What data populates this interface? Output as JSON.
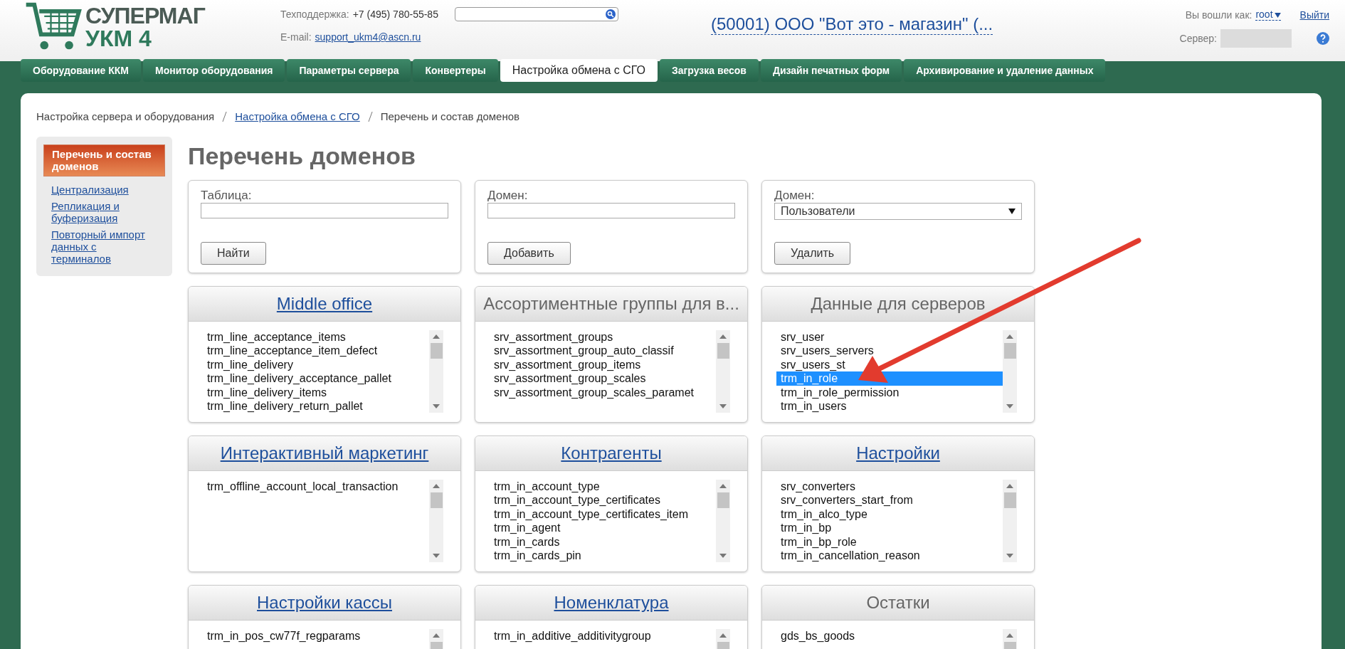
{
  "header": {
    "logo": {
      "line1": "СУПЕРМАГ",
      "line2": "УКМ 4"
    },
    "support_label": "Техподдержка:",
    "support_phone": "+7 (495) 780-55-85",
    "email_label": "E-mail:",
    "email": "support_ukm4@ascn.ru",
    "store": "(50001) ООО \"Вот это - магазин\" (...",
    "login_label": "Вы вошли как:",
    "user": "root",
    "logout": "Выйти",
    "server_label": "Сервер:"
  },
  "tabs": [
    {
      "label": "Оборудование ККМ",
      "selected": false
    },
    {
      "label": "Монитор оборудования",
      "selected": false
    },
    {
      "label": "Параметры сервера",
      "selected": false
    },
    {
      "label": "Конвертеры",
      "selected": false
    },
    {
      "label": "Настройка обмена с СГО",
      "selected": true
    },
    {
      "label": "Загрузка весов",
      "selected": false
    },
    {
      "label": "Дизайн печатных форм",
      "selected": false
    },
    {
      "label": "Архивирование и удаление данных",
      "selected": false
    }
  ],
  "breadcrumb": [
    {
      "label": "Настройка сервера и оборудования",
      "kind": "text"
    },
    {
      "label": "Настройка обмена с СГО",
      "kind": "link"
    },
    {
      "label": "Перечень и состав доменов",
      "kind": "text"
    }
  ],
  "sidebar": {
    "items": [
      {
        "label": "Перечень и состав доменов",
        "selected": true
      },
      {
        "label": "Централизация",
        "selected": false
      },
      {
        "label": "Репликация и буферизация",
        "selected": false
      },
      {
        "label": "Повторный импорт данных с терминалов",
        "selected": false
      }
    ]
  },
  "title": "Перечень доменов",
  "filters": [
    {
      "label": "Таблица:",
      "kind": "input",
      "button": "Найти"
    },
    {
      "label": "Домен:",
      "kind": "input",
      "button": "Добавить"
    },
    {
      "label": "Домен:",
      "kind": "select",
      "value": "Пользователи",
      "button": "Удалить"
    }
  ],
  "domains": [
    {
      "title": "Middle office",
      "link": true,
      "items": [
        {
          "label": "trm_line_acceptance_items",
          "selected": false
        },
        {
          "label": "trm_line_acceptance_item_defect",
          "selected": false
        },
        {
          "label": "trm_line_delivery",
          "selected": false
        },
        {
          "label": "trm_line_delivery_acceptance_pallet",
          "selected": false
        },
        {
          "label": "trm_line_delivery_items",
          "selected": false
        },
        {
          "label": "trm_line_delivery_return_pallet",
          "selected": false
        }
      ]
    },
    {
      "title": "Ассортиментные группы для в...",
      "link": false,
      "items": [
        {
          "label": "srv_assortment_groups",
          "selected": false
        },
        {
          "label": "srv_assortment_group_auto_classif",
          "selected": false
        },
        {
          "label": "srv_assortment_group_items",
          "selected": false
        },
        {
          "label": "srv_assortment_group_scales",
          "selected": false
        },
        {
          "label": "srv_assortment_group_scales_paramet",
          "selected": false
        }
      ]
    },
    {
      "title": "Данные для серверов",
      "link": false,
      "items": [
        {
          "label": "srv_user",
          "selected": false
        },
        {
          "label": "srv_users_servers",
          "selected": false
        },
        {
          "label": "srv_users_st",
          "selected": false
        },
        {
          "label": "trm_in_role",
          "selected": true
        },
        {
          "label": "trm_in_role_permission",
          "selected": false
        },
        {
          "label": "trm_in_users",
          "selected": false
        }
      ]
    },
    {
      "title": "Интерактивный маркетинг",
      "link": true,
      "items": [
        {
          "label": "trm_offline_account_local_transaction",
          "selected": false
        }
      ]
    },
    {
      "title": "Контрагенты",
      "link": true,
      "items": [
        {
          "label": "trm_in_account_type",
          "selected": false
        },
        {
          "label": "trm_in_account_type_certificates",
          "selected": false
        },
        {
          "label": "trm_in_account_type_certificates_item",
          "selected": false
        },
        {
          "label": "trm_in_agent",
          "selected": false
        },
        {
          "label": "trm_in_cards",
          "selected": false
        },
        {
          "label": "trm_in_cards_pin",
          "selected": false
        }
      ]
    },
    {
      "title": "Настройки",
      "link": true,
      "items": [
        {
          "label": "srv_converters",
          "selected": false
        },
        {
          "label": "srv_converters_start_from",
          "selected": false
        },
        {
          "label": "trm_in_alco_type",
          "selected": false
        },
        {
          "label": "trm_in_bp",
          "selected": false
        },
        {
          "label": "trm_in_bp_role",
          "selected": false
        },
        {
          "label": "trm_in_cancellation_reason",
          "selected": false
        }
      ]
    },
    {
      "title": "Настройки кассы",
      "link": true,
      "items": [
        {
          "label": "trm_in_pos_cw77f_regparams",
          "selected": false
        }
      ]
    },
    {
      "title": "Номенклатура",
      "link": true,
      "items": [
        {
          "label": "trm_in_additive_additivitygroup",
          "selected": false
        }
      ]
    },
    {
      "title": "Остатки",
      "link": false,
      "items": [
        {
          "label": "gds_bs_goods",
          "selected": false
        }
      ]
    }
  ]
}
